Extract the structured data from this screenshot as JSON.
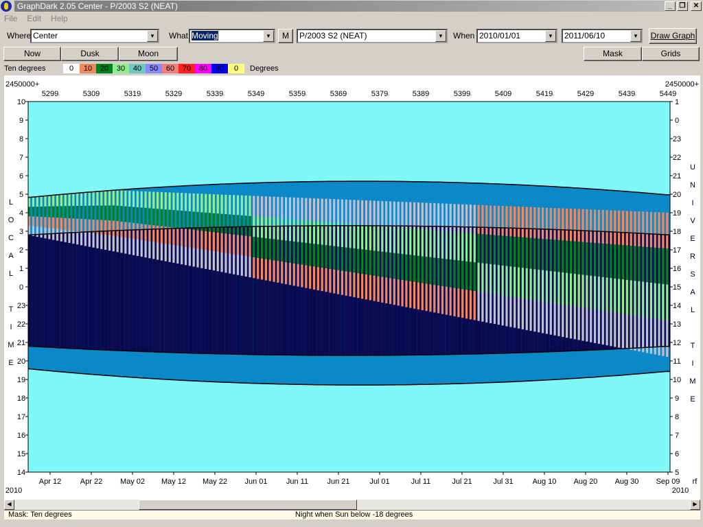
{
  "window": {
    "title": "GraphDark 2.05  Center  -  P/2003 S2 (NEAT)",
    "min": "_",
    "max": "❐",
    "close": "✕"
  },
  "menu": [
    "File",
    "Edit",
    "Help"
  ],
  "toolbar": {
    "where_label": "Where",
    "where_value": "Center",
    "what_label": "What",
    "what_value": "Moving",
    "m_button": "M",
    "object_value": "P/2003 S2 (NEAT)",
    "when_label": "When",
    "start_date": "2010/01/01",
    "end_date": "2011/06/10",
    "draw_button": "Draw Graph"
  },
  "buttons": {
    "now": "Now",
    "dusk": "Dusk",
    "moon": "Moon",
    "mask": "Mask",
    "grids": "Grids"
  },
  "legend": {
    "title": "Ten degrees",
    "units": "Degrees",
    "entries": [
      {
        "label": "0",
        "color": "#ffffff"
      },
      {
        "label": "10",
        "color": "#f08860"
      },
      {
        "label": "20",
        "color": "#008020"
      },
      {
        "label": "30",
        "color": "#90ee90"
      },
      {
        "label": "40",
        "color": "#70c8c0"
      },
      {
        "label": "50",
        "color": "#8888ff"
      },
      {
        "label": "60",
        "color": "#f08080"
      },
      {
        "label": "70",
        "color": "#ff2020"
      },
      {
        "label": "80",
        "color": "#ff00ff"
      },
      {
        "label": "90",
        "color": "#0000ff"
      },
      {
        "label": "0",
        "color": "#ffff80"
      }
    ]
  },
  "chart": {
    "jd_prefix_left": "2450000+",
    "jd_prefix_right": "2450000+",
    "jd_ticks": [
      "5299",
      "5309",
      "5319",
      "5329",
      "5339",
      "5349",
      "5359",
      "5369",
      "5379",
      "5389",
      "5399",
      "5409",
      "5419",
      "5429",
      "5439",
      "5449"
    ],
    "date_ticks": [
      "Apr 12",
      "Apr 22",
      "May 02",
      "May 12",
      "May 22",
      "Jun 01",
      "Jun 11",
      "Jun 21",
      "Jul 01",
      "Jul 11",
      "Jul 21",
      "Jul 31",
      "Aug 10",
      "Aug 20",
      "Aug 30",
      "Sep 09"
    ],
    "year_left": "2010",
    "year_right": "2010",
    "right_edge_label": "rf",
    "left_hours": [
      "10",
      "9",
      "8",
      "7",
      "6",
      "5",
      "4",
      "3",
      "2",
      "1",
      "0",
      "23",
      "22",
      "21",
      "20",
      "19",
      "18",
      "17",
      "16",
      "15",
      "14"
    ],
    "right_hours": [
      "1",
      "0",
      "23",
      "22",
      "21",
      "20",
      "19",
      "18",
      "17",
      "16",
      "15",
      "14",
      "13",
      "12",
      "11",
      "10",
      "9",
      "8",
      "7",
      "6",
      "5"
    ],
    "left_axis_title": [
      "L",
      "O",
      "C",
      "A",
      "L",
      "",
      "T",
      "I",
      "M",
      "E"
    ],
    "right_axis_title": [
      "U",
      "N",
      "I",
      "V",
      "E",
      "R",
      "S",
      "A",
      "L",
      "",
      "T",
      "I",
      "M",
      "E"
    ]
  },
  "colors": {
    "sky": "#80f8f8",
    "night": "#0a0a50",
    "twilight": "#0a88c8",
    "grey": "#c0c0d0",
    "ten": "#f08860",
    "twenty": "#008020",
    "thirty": "#90ee90",
    "stripe": "#000000"
  },
  "status": {
    "mask": "Mask:  Ten degrees",
    "night": "Night when Sun below -18 degrees"
  }
}
